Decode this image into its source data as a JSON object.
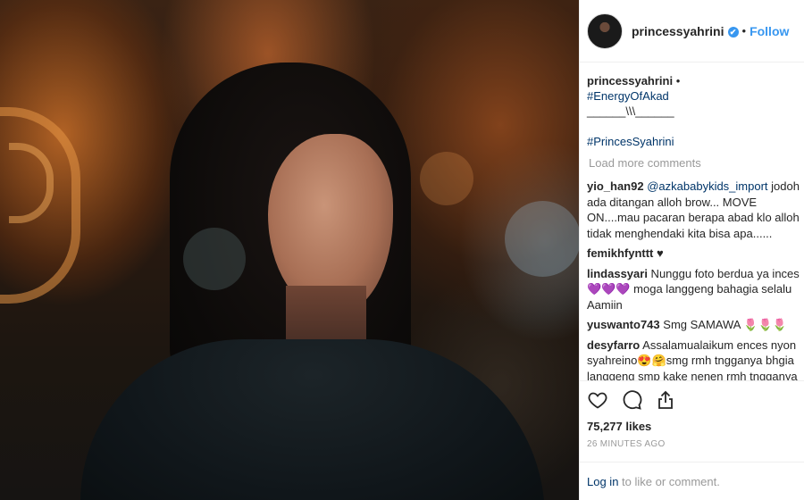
{
  "post": {
    "username": "princessyahrini",
    "verified_glyph": "✔",
    "dot": "•",
    "follow_label": "Follow",
    "caption": {
      "username": "princessyahrini",
      "bullet": "•",
      "hashtag1": "#EnergyOfAkad",
      "line": "______\\\\\\______",
      "hashtag2": "#PrincesSyahrini"
    },
    "load_more": "Load more comments",
    "comments": [
      {
        "user": "yio_han92",
        "mention": "@azkababykids_import",
        "lines": [
          " jodoh",
          "ada ditangan alloh brow... MOVE",
          "ON....mau pacaran berapa abad klo alloh",
          "tidak menghendaki kita bisa apa......"
        ]
      },
      {
        "user": "femikhfynttt",
        "text": " ♥"
      },
      {
        "user": "lindassyari",
        "lines": [
          " Nunggu foto berdua ya inces",
          "💜💜💜 moga langgeng bahagia selalu",
          "Aamiin"
        ]
      },
      {
        "user": "yuswanto743",
        "text": " Smg SAMAWA 🌷🌷🌷"
      },
      {
        "user": "desyfarro",
        "lines": [
          " Assalamualaikum ences nyon",
          "syahreino😍🤗smg rmh tngganya bhgia",
          "langgeng smp kake nenen rmh tngganya"
        ]
      }
    ],
    "likes": "75,277 likes",
    "timestamp": "26 MINUTES AGO",
    "login_link": "Log in",
    "login_rest": " to like or comment."
  },
  "icons": [
    "heart-icon",
    "comment-icon",
    "share-icon"
  ],
  "colors": {
    "link": "#003569",
    "follow": "#3897f0",
    "muted": "#999999",
    "border": "#efefef"
  }
}
